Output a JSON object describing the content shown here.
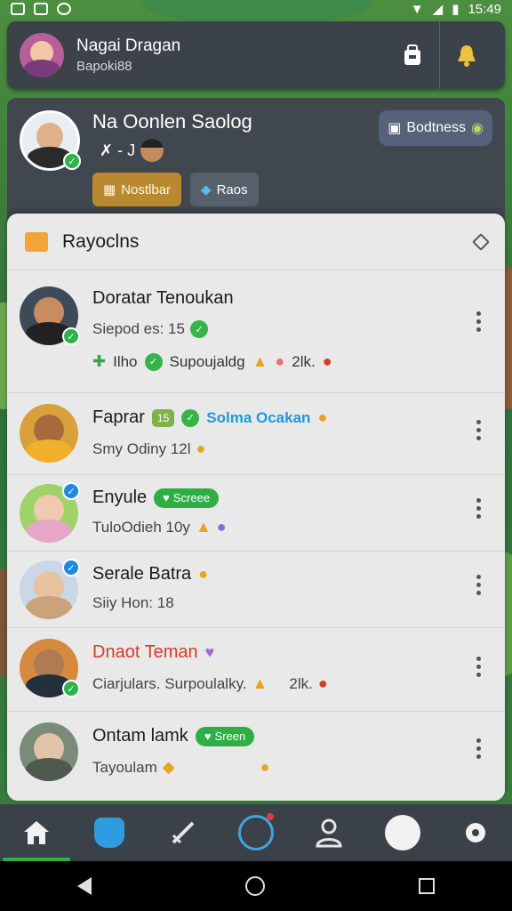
{
  "status_bar": {
    "time": "15:49"
  },
  "header": {
    "name": "Nagai Dragan",
    "subtitle": "Bapoki88",
    "actions": [
      "backpack-icon",
      "bell-icon"
    ]
  },
  "profile": {
    "name": "Na Oonlen Saolog",
    "line": "✗ - J",
    "tags": [
      {
        "label": "Nostlbar",
        "icon": "map-icon"
      },
      {
        "label": "Raos",
        "icon": "crystal-icon"
      }
    ],
    "badge": "Bodtness"
  },
  "list": {
    "title": "Rayoclns",
    "rows": [
      {
        "name": "Doratar Tenoukan",
        "sub": "Siepod es: 15",
        "extra": [
          "Ilho",
          "Supoujaldg",
          "2lk."
        ],
        "avatar_color": "#3e4a57",
        "status": "online"
      },
      {
        "name": "Faprar",
        "name_pill": "15",
        "highlight": "Solma Ocakan",
        "sub": "Smy Odiny 12l",
        "avatar_color": "#d9a13b",
        "status": "none"
      },
      {
        "name": "Enyule",
        "name_pill": "Screee",
        "sub": "TuloOdieh 10y",
        "avatar_color": "#9fd36a",
        "status": "verified"
      },
      {
        "name": "Serale Batra",
        "sub": "Siiy Hon: 18",
        "avatar_color": "#c9d7e6",
        "status": "verified"
      },
      {
        "name": "Dnaot Teman",
        "sub": "Ciarjulars. Surpoulalky.",
        "sub_extra": "2lk.",
        "avatar_color": "#d58a3f",
        "status": "online",
        "name_color": "#d63a2b"
      },
      {
        "name": "Ontam lamk",
        "name_pill": "Sreen",
        "sub": "Tayoulam",
        "avatar_color": "#7a8b7a",
        "status": "none"
      }
    ]
  },
  "bottom_nav": [
    "home-icon",
    "shield-icon",
    "sword-icon",
    "compass-icon",
    "profile-icon",
    "badge-icon",
    "settings-icon"
  ],
  "colors": {
    "accent_green": "#2fae45",
    "panel_dark": "#3b4249",
    "list_bg": "#e9e9ea"
  }
}
